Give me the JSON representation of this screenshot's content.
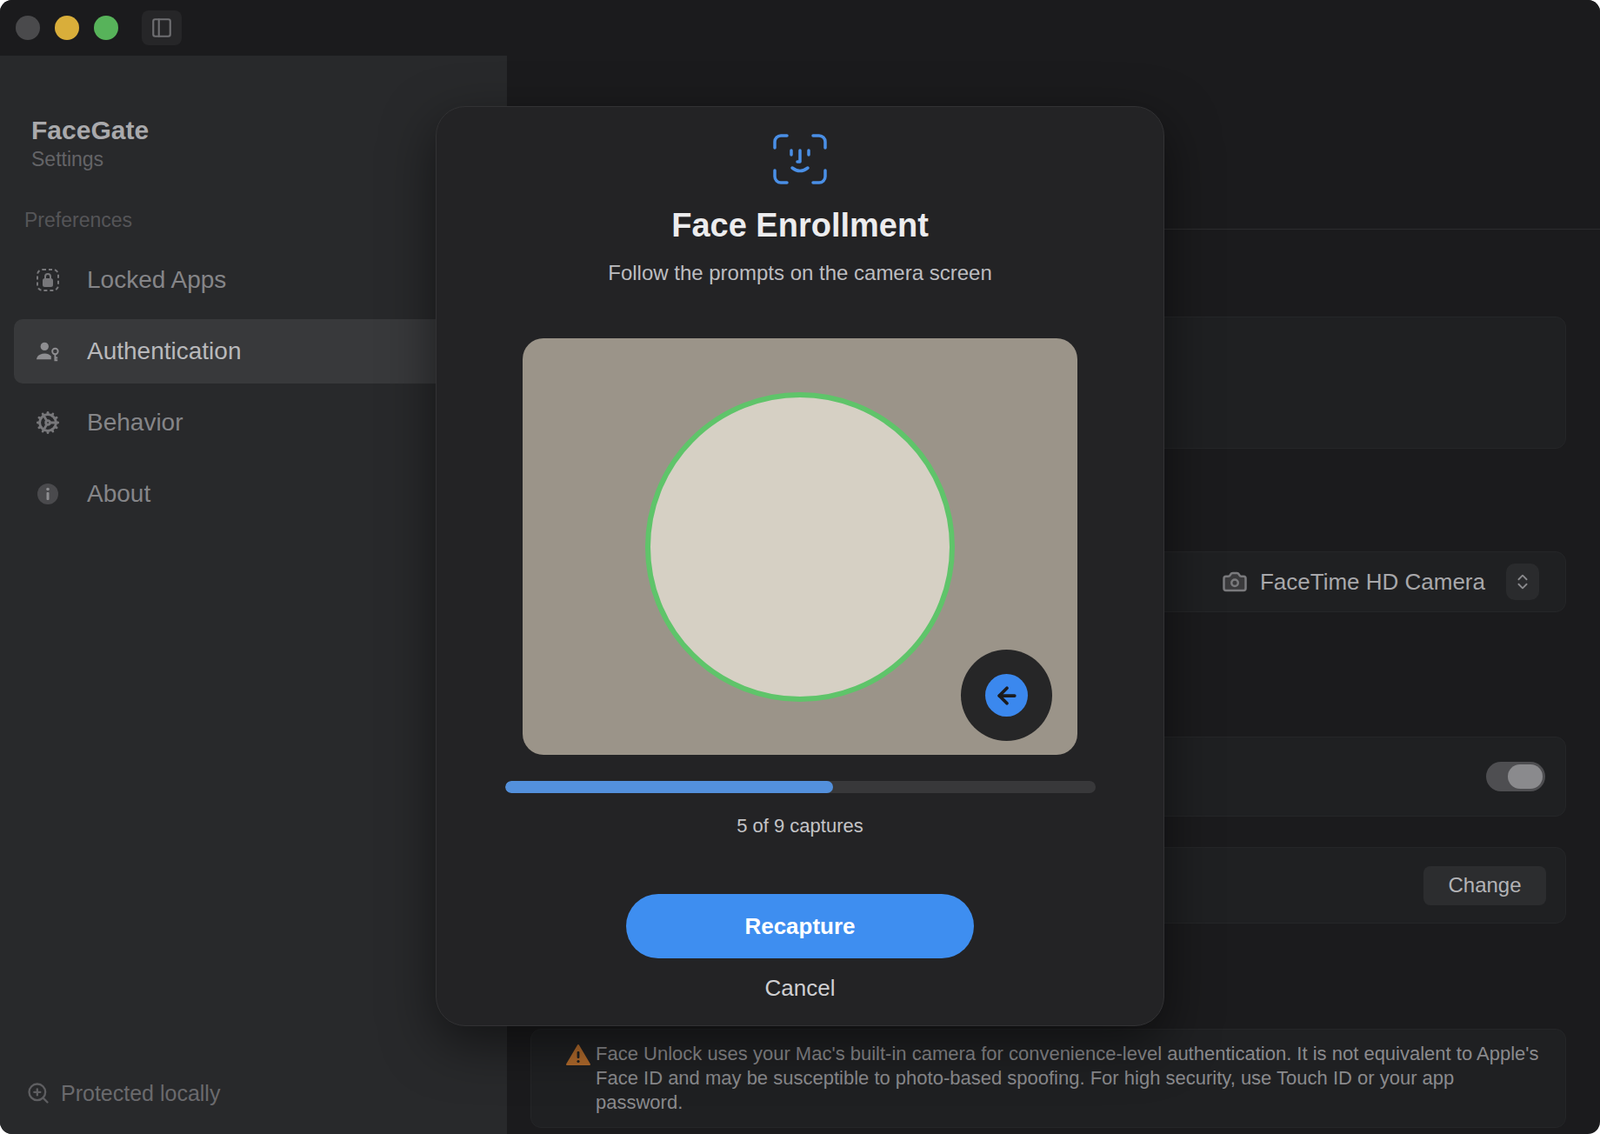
{
  "sidebar": {
    "title": "FaceGate",
    "subtitle": "Settings",
    "section": "Preferences",
    "items": [
      {
        "label": "Locked Apps",
        "selected": false
      },
      {
        "label": "Authentication",
        "selected": true
      },
      {
        "label": "Behavior",
        "selected": false
      },
      {
        "label": "About",
        "selected": false
      }
    ],
    "footer": "Protected locally"
  },
  "settings": {
    "camera": {
      "value": "FaceTime HD Camera"
    },
    "toggle": {
      "on": true
    },
    "change_button": "Change",
    "notice": "Face Unlock uses your Mac's built-in camera for convenience-level authentication. It is not equivalent to Apple's Face ID and may be susceptible to photo-based spoofing. For high security, use Touch ID or your app password."
  },
  "dialog": {
    "title": "Face Enrollment",
    "subtitle": "Follow the prompts on the camera screen",
    "camera": {
      "face_aligned": true
    },
    "progress": {
      "level": 0.556,
      "label": "5 of 9 captures"
    },
    "buttons": [
      {
        "label": "Recapture",
        "kind": "primary"
      },
      {
        "label": "Cancel",
        "kind": "plain"
      }
    ]
  }
}
